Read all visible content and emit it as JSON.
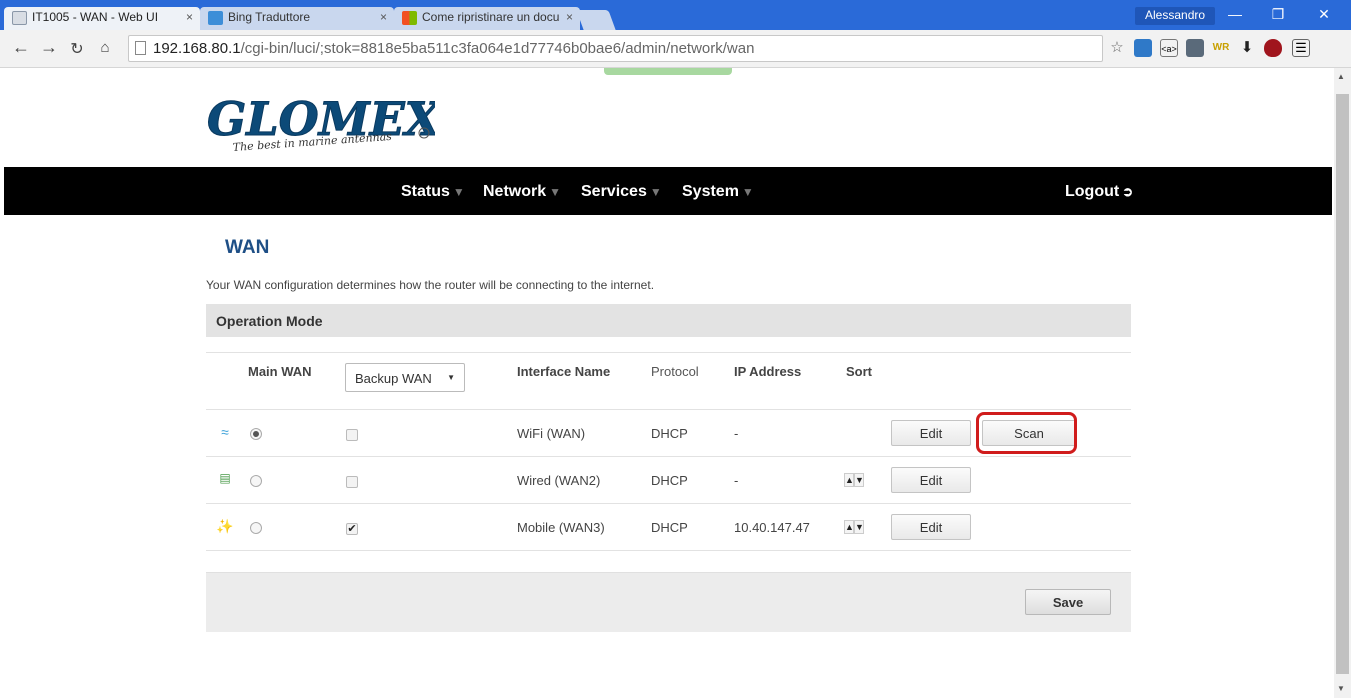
{
  "browser": {
    "tabs": [
      {
        "title": "IT1005 - WAN - Web UI",
        "close": "×",
        "active": true
      },
      {
        "title": "Bing Traduttore",
        "close": "×",
        "active": false
      },
      {
        "title": "Come ripristinare un docu",
        "close": "×",
        "active": false
      }
    ],
    "user": "Alessandro",
    "url_host": "192.168.80.1",
    "url_path": "/cgi-bin/luci/;stok=8818e5ba511c3fa064e1d77746b0bae6/admin/network/wan"
  },
  "logo": {
    "brand": "GLOMEX",
    "tagline": "The best in marine antennas"
  },
  "nav": {
    "items": [
      {
        "label": "Status"
      },
      {
        "label": "Network"
      },
      {
        "label": "Services"
      },
      {
        "label": "System"
      }
    ],
    "logout": "Logout"
  },
  "page": {
    "title": "WAN",
    "description": "Your WAN configuration determines how the router will be connecting to the internet.",
    "section": "Operation Mode"
  },
  "table": {
    "headers": {
      "main_wan": "Main WAN",
      "backup_select": "Backup WAN",
      "interface": "Interface Name",
      "protocol": "Protocol",
      "ip": "IP Address",
      "sort": "Sort"
    },
    "rows": [
      {
        "icon": "wifi-icon",
        "main_selected": true,
        "backup_checked": false,
        "interface": "WiFi (WAN)",
        "protocol": "DHCP",
        "ip": "-",
        "edit": "Edit",
        "scan": "Scan"
      },
      {
        "icon": "ethernet-icon",
        "main_selected": false,
        "backup_checked": false,
        "interface": "Wired (WAN2)",
        "protocol": "DHCP",
        "ip": "-",
        "edit": "Edit"
      },
      {
        "icon": "mobile-antenna-icon",
        "main_selected": false,
        "backup_checked": true,
        "interface": "Mobile (WAN3)",
        "protocol": "DHCP",
        "ip": "10.40.147.47",
        "edit": "Edit"
      }
    ]
  },
  "actions": {
    "save": "Save"
  },
  "colors": {
    "nav_bg": "#000000",
    "title": "#1e4f86",
    "highlight": "#d01c1c",
    "chrome": "#2a6ad8"
  }
}
